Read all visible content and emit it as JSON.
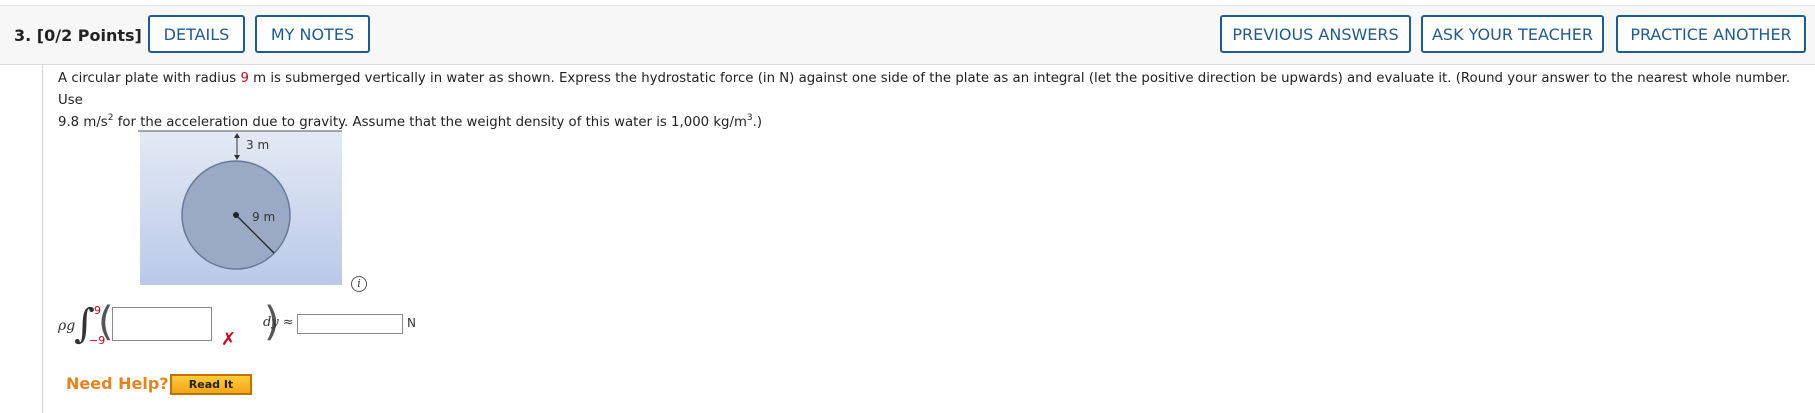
{
  "question": {
    "number": "3.",
    "points": "[0/2 Points]"
  },
  "header_buttons": {
    "details": "DETAILS",
    "my_notes": "MY NOTES",
    "previous_answers": "PREVIOUS ANSWERS",
    "ask_teacher": "ASK YOUR TEACHER",
    "practice_another": "PRACTICE ANOTHER"
  },
  "prompt": {
    "part1": "A circular plate with radius ",
    "radius": "9",
    "part2": " m is submerged vertically in water as shown. Express the hydrostatic force (in N) against one side of the plate as an integral (let the positive direction be upwards) and evaluate it. (Round your answer to the nearest whole number. Use",
    "part3": "9.8 m/s",
    "exp2": "2",
    "part4": " for the acceleration due to gravity. Assume that the weight density of this water is 1,000 kg/m",
    "exp3": "3",
    "part5": ".)"
  },
  "figure": {
    "depth_label": "3 m",
    "radius_label": "9 m"
  },
  "formula": {
    "rho_g": "ρg",
    "integral": "∫",
    "upper_limit": "9",
    "lower_limit": "−9",
    "integrand_value": "",
    "integrand_status": "incorrect",
    "dy_label": "dy ≈",
    "result_value": "",
    "unit": "N",
    "incorrect_mark": "✗"
  },
  "help": {
    "need_help": "Need Help?",
    "read_it": "Read It"
  },
  "colors": {
    "accent": "#1d5c91",
    "error": "#d0021b",
    "help": "#e8821d"
  },
  "info_icon": "i"
}
